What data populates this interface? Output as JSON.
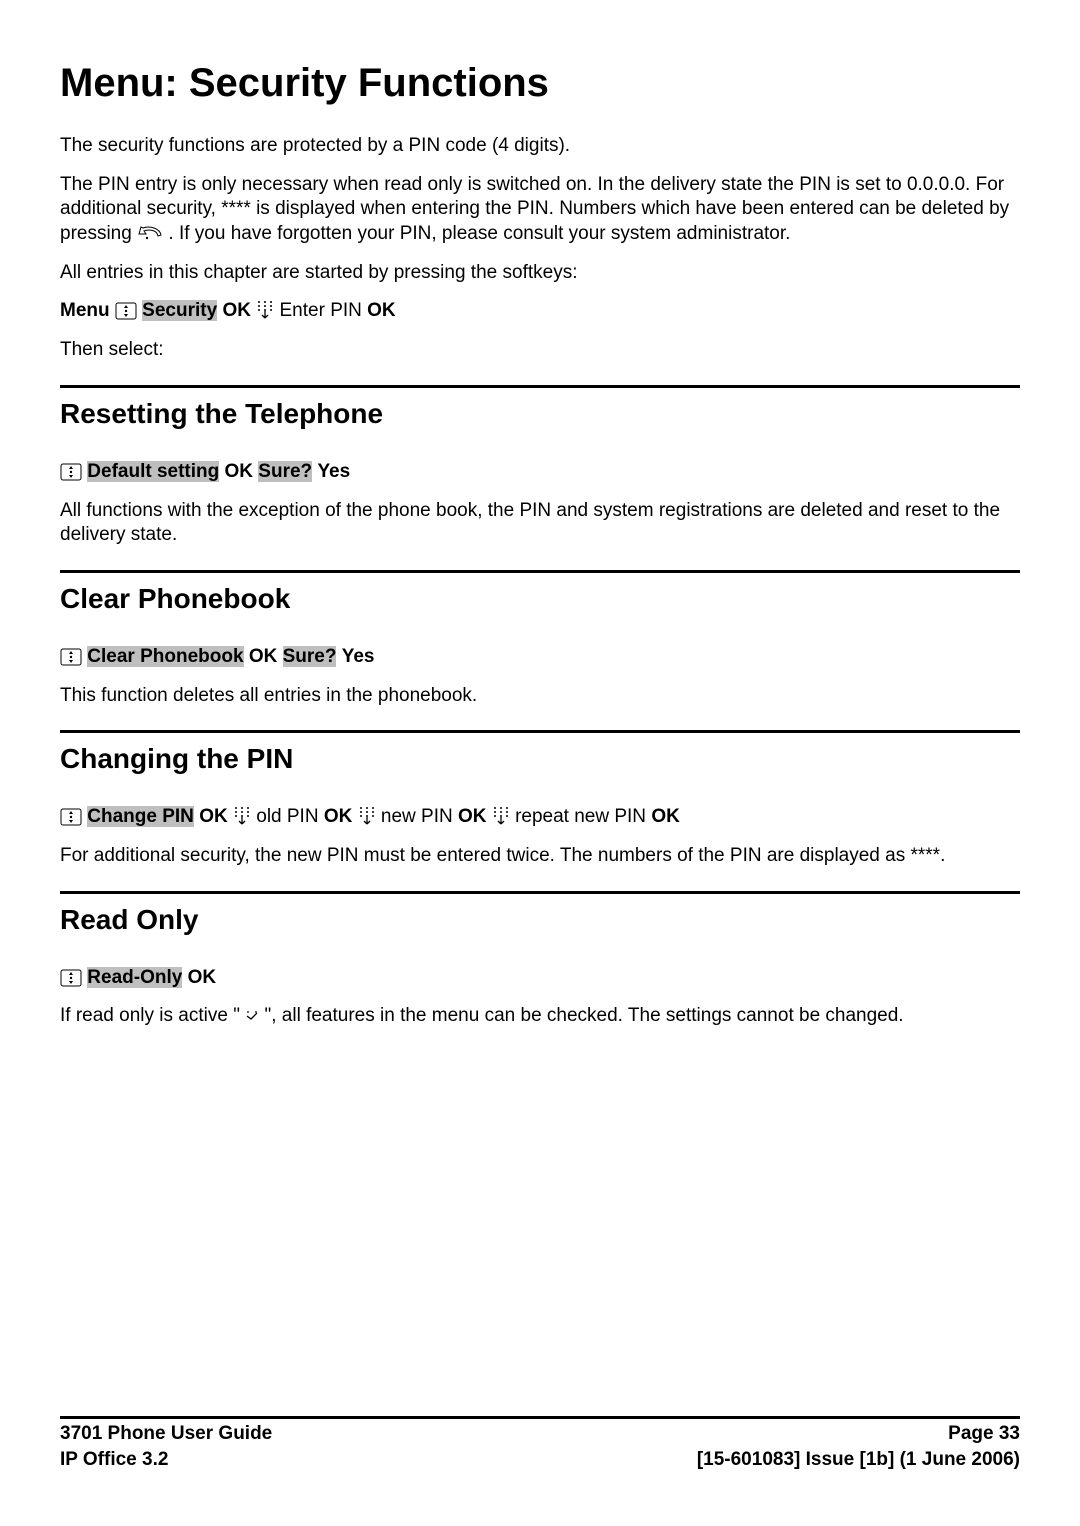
{
  "title": "Menu: Security Functions",
  "intro": {
    "p1": "The security functions are protected by a PIN code (4 digits).",
    "p2a": "The PIN entry is only necessary when read only is switched on. In the delivery state the PIN is set to 0.0.0.0. For additional security, **** is displayed when entering the PIN. Numbers which have been entered can be deleted by pressing ",
    "p2b": ". If you have forgotten your PIN, please consult your system administrator.",
    "p3": "All entries in this chapter are started by pressing the softkeys:",
    "seq": {
      "menu": "Menu",
      "security": "Security",
      "ok1": " OK ",
      "enterpin": " Enter PIN ",
      "ok2": "OK"
    },
    "then": "Then select:"
  },
  "sections": {
    "reset": {
      "heading": "Resetting the Telephone",
      "seq": {
        "defaultsetting": "Default setting",
        "ok": " OK ",
        "sure": "Sure?",
        "yes": " Yes"
      },
      "body": "All functions with the exception of the phone book, the PIN and system registrations are deleted and reset to the delivery state."
    },
    "clear": {
      "heading": "Clear Phonebook",
      "seq": {
        "clearpb": "Clear Phonebook",
        "ok": " OK ",
        "sure": "Sure?",
        "yes": " Yes"
      },
      "body": "This function deletes all entries in the phonebook."
    },
    "pin": {
      "heading": "Changing the PIN",
      "seq": {
        "changepin": "Change PIN",
        "ok1": " OK ",
        "old": " old PIN ",
        "ok2": "OK ",
        "newp": " new PIN ",
        "ok3": "OK ",
        "repeat": " repeat new PIN ",
        "ok4": "OK"
      },
      "body": "For additional security, the new PIN must be entered twice. The numbers of the PIN are displayed as ****."
    },
    "readonly": {
      "heading": "Read Only",
      "seq": {
        "readonly": "Read-Only",
        "ok": " OK"
      },
      "body_a": "If read only is active \"",
      "body_b": "\", all features in the menu can be checked. The settings cannot be changed."
    }
  },
  "footer": {
    "left1": "3701 Phone User Guide",
    "left2": "IP Office 3.2",
    "right1": "Page 33",
    "right2": "[15-601083] Issue [1b] (1 June 2006)"
  }
}
